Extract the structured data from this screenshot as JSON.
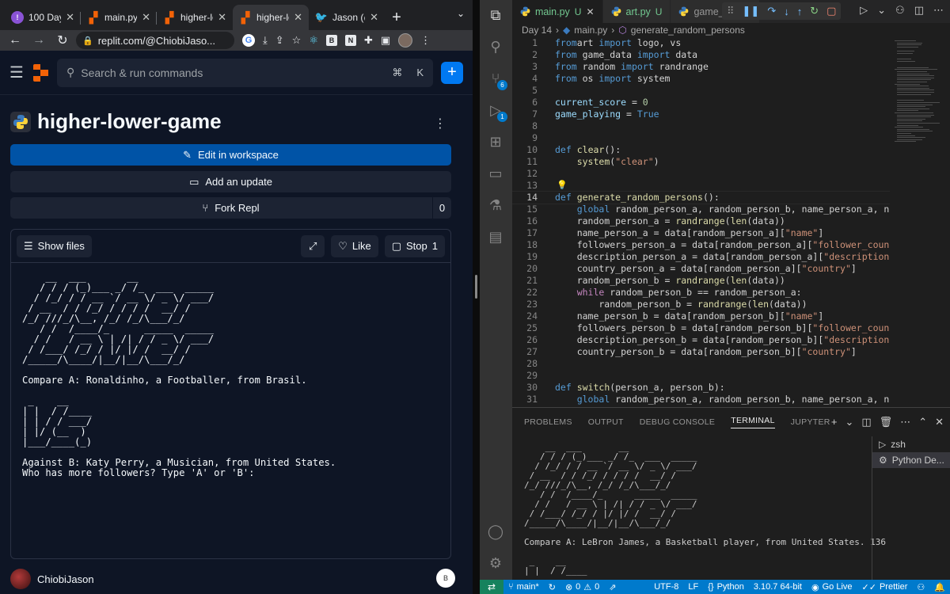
{
  "browser": {
    "tabs": [
      {
        "title": "100 Days",
        "icon": "purple-badge"
      },
      {
        "title": "main.py -",
        "icon": "replit-logo"
      },
      {
        "title": "higher-lo",
        "icon": "replit-logo"
      },
      {
        "title": "higher-lo",
        "icon": "replit-logo",
        "active": true
      },
      {
        "title": "Jason (@",
        "icon": "twitter-bird"
      }
    ],
    "url": "replit.com/@ChiobiJaso..."
  },
  "replit": {
    "search_placeholder": "Search & run commands",
    "shortcut_symbol": "⌘",
    "shortcut_key": "K",
    "repl_title": "higher-lower-game",
    "edit_button": "Edit in workspace",
    "update_button": "Add an update",
    "fork_button": "Fork Repl",
    "fork_count": "0",
    "show_files": "Show files",
    "like": "Like",
    "stop": "Stop",
    "stop_count": "1",
    "console_output": "    __  ___       __\n   / / / (_)___ _/ /_  ___  _____\n  / /_/ / / __ `/ __ \\/ _ \\/ ___/\n / __  / / /_/ / / / /  __/ /\n/_/ ///_/\\__, /_/ /_/\\___/_/\n   / /  /____/_      _____  _____\n  / /   / __ \\ | /| / / _ \\/ ___/\n / /___/ /_/ / |/ |/ /  __/ /\n/_____/\\____/|__/|__/\\___/_/\n\nCompare A: Ronaldinho, a Footballer, from Brasil.\n\n _    __\n| |  / /____\n| | / / ___/\n| |/ (__  )\n|___/____(_)\n\nAgainst B: Katy Perry, a Musician, from United States.\nWho has more followers? Type 'A' or 'B':",
    "username": "ChiobiJason",
    "user_badge": "B"
  },
  "vscode": {
    "tabs": [
      {
        "label": "main.py",
        "status": "U",
        "active": true
      },
      {
        "label": "art.py",
        "status": "U"
      },
      {
        "label": "game_data.p",
        "status": ""
      }
    ],
    "breadcrumb": [
      "Day 14",
      "main.py",
      "generate_random_persons"
    ],
    "code_lines": [
      [
        [
          "k",
          "from"
        ],
        [
          "",
          "art "
        ],
        [
          "k",
          "import"
        ],
        [
          "",
          " logo, vs"
        ]
      ],
      [
        [
          "k",
          "from"
        ],
        [
          "",
          " game_data "
        ],
        [
          "k",
          "import"
        ],
        [
          "",
          " data"
        ]
      ],
      [
        [
          "k",
          "from"
        ],
        [
          "",
          " random "
        ],
        [
          "k",
          "import"
        ],
        [
          "",
          " randrange"
        ]
      ],
      [
        [
          "k",
          "from"
        ],
        [
          "",
          " os "
        ],
        [
          "k",
          "import"
        ],
        [
          "",
          " system"
        ]
      ],
      [],
      [
        [
          "v",
          "current_score"
        ],
        [
          "",
          " = "
        ],
        [
          "n",
          "0"
        ]
      ],
      [
        [
          "v",
          "game_playing"
        ],
        [
          "",
          " = "
        ],
        [
          "k",
          "True"
        ]
      ],
      [],
      [],
      [
        [
          "k",
          "def"
        ],
        [
          "",
          " "
        ],
        [
          "f",
          "clear"
        ],
        [
          "",
          "():"
        ]
      ],
      [
        [
          "",
          "    "
        ],
        [
          "f",
          "system"
        ],
        [
          "",
          "("
        ],
        [
          "s",
          "\"clear\""
        ],
        [
          "",
          ")"
        ]
      ],
      [],
      [],
      [
        [
          "k",
          "def"
        ],
        [
          "",
          " "
        ],
        [
          "f",
          "generate_random_persons"
        ],
        [
          "",
          "():"
        ]
      ],
      [
        [
          "",
          "    "
        ],
        [
          "k",
          "global"
        ],
        [
          "",
          " random_person_a, random_person_b, name_person_a, name_perso"
        ]
      ],
      [
        [
          "",
          "    random_person_a = "
        ],
        [
          "f",
          "randrange"
        ],
        [
          "",
          "("
        ],
        [
          "f",
          "len"
        ],
        [
          "",
          "(data))"
        ]
      ],
      [
        [
          "",
          "    name_person_a = data[random_person_a]["
        ],
        [
          "s",
          "\"name\""
        ],
        [
          "",
          "]"
        ]
      ],
      [
        [
          "",
          "    followers_person_a = data[random_person_a]["
        ],
        [
          "s",
          "\"follower_count\""
        ],
        [
          "",
          "]"
        ]
      ],
      [
        [
          "",
          "    description_person_a = data[random_person_a]["
        ],
        [
          "s",
          "\"description\""
        ],
        [
          "",
          "]"
        ]
      ],
      [
        [
          "",
          "    country_person_a = data[random_person_a]["
        ],
        [
          "s",
          "\"country\""
        ],
        [
          "",
          "]"
        ]
      ],
      [
        [
          "",
          "    random_person_b = "
        ],
        [
          "f",
          "randrange"
        ],
        [
          "",
          "("
        ],
        [
          "f",
          "len"
        ],
        [
          "",
          "(data))"
        ]
      ],
      [
        [
          "",
          "    "
        ],
        [
          "kc",
          "while"
        ],
        [
          "",
          " random_person_b == random_person_a:"
        ]
      ],
      [
        [
          "",
          "        random_person_b = "
        ],
        [
          "f",
          "randrange"
        ],
        [
          "",
          "("
        ],
        [
          "f",
          "len"
        ],
        [
          "",
          "(data))"
        ]
      ],
      [
        [
          "",
          "    name_person_b = data[random_person_b]["
        ],
        [
          "s",
          "\"name\""
        ],
        [
          "",
          "]"
        ]
      ],
      [
        [
          "",
          "    followers_person_b = data[random_person_b]["
        ],
        [
          "s",
          "\"follower_count\""
        ],
        [
          "",
          "]"
        ]
      ],
      [
        [
          "",
          "    description_person_b = data[random_person_b]["
        ],
        [
          "s",
          "\"description\""
        ],
        [
          "",
          "]"
        ]
      ],
      [
        [
          "",
          "    country_person_b = data[random_person_b]["
        ],
        [
          "s",
          "\"country\""
        ],
        [
          "",
          "]"
        ]
      ],
      [],
      [],
      [
        [
          "k",
          "def"
        ],
        [
          "",
          " "
        ],
        [
          "f",
          "switch"
        ],
        [
          "",
          "(person_a, person_b):"
        ]
      ],
      [
        [
          "",
          "    "
        ],
        [
          "k",
          "global"
        ],
        [
          "",
          " random_person_a, random_person_b, name_person_a, name_perso"
        ]
      ]
    ],
    "panel_tabs": [
      "PROBLEMS",
      "OUTPUT",
      "DEBUG CONSOLE",
      "TERMINAL",
      "JUPYTER"
    ],
    "terminal_output": "    __  ___       __\n   / / / (_)___ _/ /_  ___  _____\n  / /_/ / / __ `/ __ \\/ _ \\/ ___/\n / __  / / /_/ / / / /  __/ /\n/_/ ///_/\\__, /_/ /_/\\___/_/\n   / /  /____/_      _____  _____\n  / /   / __ \\ | /| / / _ \\/ ___/\n / /___/ /_/ / |/ |/ /  __/ /\n/_____/\\____/|__/|__/\\___/_/\n\nCompare A: LeBron James, a Basketball player, from United States. 136\n\n _    __\n| |  / /____",
    "terminals": [
      "zsh",
      "Python De..."
    ],
    "status": {
      "branch": "main*",
      "errors": "0",
      "warnings": "0",
      "encoding": "UTF-8",
      "eol": "LF",
      "language": "Python",
      "interpreter": "3.10.7 64-bit",
      "golive": "Go Live",
      "prettier": "Prettier"
    },
    "badges": {
      "scm": "6",
      "debug": "1"
    }
  },
  "colors": {
    "replit_accent": "#f26207",
    "replit_primary": "#0053a6",
    "vscode_status": "#007acc"
  }
}
